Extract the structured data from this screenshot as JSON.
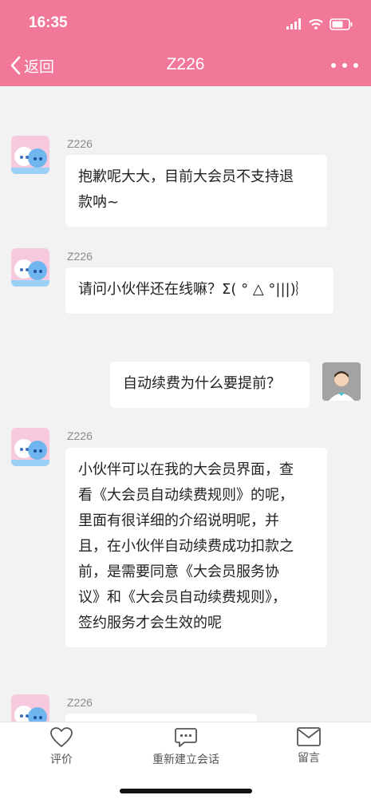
{
  "status_bar": {
    "time": "16:35"
  },
  "nav": {
    "back_label": "返回",
    "title": "Z226",
    "more_icon": "more-dots-icon"
  },
  "messages": [
    {
      "from": "agent",
      "sender": "Z226",
      "lines": [
        "抱歉呢大大，目前大会员不支持退",
        "款呐~"
      ]
    },
    {
      "from": "agent",
      "sender": "Z226",
      "lines": [
        "请问小伙伴还在线嘛？Σ( ° △ °|||)︴"
      ]
    },
    {
      "from": "user",
      "lines": [
        "自动续费为什么要提前？"
      ]
    },
    {
      "from": "agent",
      "sender": "Z226",
      "lines": [
        "小伙伴可以在我的大会员界面，查",
        "看《大会员自动续费规则》的呢，",
        "里面有很详细的介绍说明呢，并",
        "且，在小伙伴自动续费成功扣款之",
        "前，是需要同意《大会员服务协",
        "议》和《大会员自动续费规则》，",
        "签约服务才会生效的呢"
      ]
    },
    {
      "from": "agent",
      "sender": "Z226",
      "lines": []
    }
  ],
  "bottom_tabs": [
    {
      "label": "评价",
      "icon": "heart-icon"
    },
    {
      "label": "重新建立会话",
      "icon": "chat-bubble-icon"
    },
    {
      "label": "留言",
      "icon": "envelope-icon"
    }
  ],
  "colors": {
    "header": "#f2789a",
    "background": "#f2f2f2",
    "bubble": "#ffffff"
  }
}
